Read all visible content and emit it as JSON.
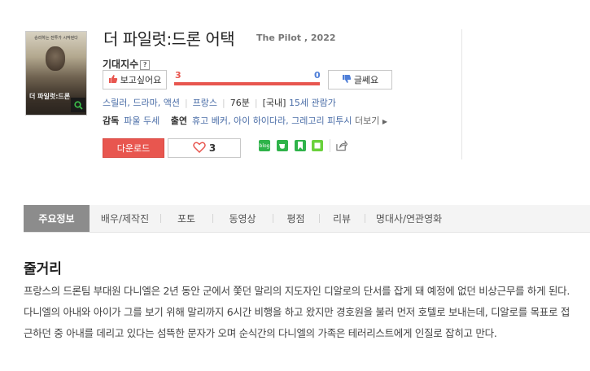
{
  "movie": {
    "title": "더 파일럿:드론 어택",
    "subtitle": "The Pilot , 2022",
    "poster": {
      "top_text": "승리하는 전투가 시작된다",
      "title_text": "더 파일럿:드론"
    }
  },
  "expectation": {
    "label": "기대지수",
    "help_icon": "?",
    "want_label": "보고싶어요",
    "want_count": "3",
    "nah_label": "글쎄요",
    "nah_count": "0",
    "want_ratio": 1.0
  },
  "meta": {
    "genres": "스릴러, 드라마, 액션",
    "country": "프랑스",
    "runtime": "76분",
    "rating_prefix": "[국내]",
    "rating": "15세 관람가"
  },
  "credits": {
    "director_label": "감독",
    "director": "파울 두세",
    "cast_label": "출연",
    "cast": "휴고 베커, 아이 하이다라, 그레고리 피투시",
    "more_label": "더보기"
  },
  "actions": {
    "download_label": "다운로드",
    "like_count": "3",
    "share_icons": [
      {
        "name": "blog-share-icon",
        "color": "#2fb34a",
        "text": "blog"
      },
      {
        "name": "cafe-share-icon",
        "color": "#2fb34a",
        "text": "C"
      },
      {
        "name": "bookmark-share-icon",
        "color": "#2fb34a",
        "text": "B"
      },
      {
        "name": "band-share-icon",
        "color": "#6ad13c",
        "text": "D"
      }
    ]
  },
  "tabs": [
    {
      "label": "주요정보",
      "active": true
    },
    {
      "label": "배우/제작진",
      "active": false
    },
    {
      "label": "포토",
      "active": false
    },
    {
      "label": "동영상",
      "active": false
    },
    {
      "label": "평점",
      "active": false
    },
    {
      "label": "리뷰",
      "active": false
    },
    {
      "label": "명대사/연관영화",
      "active": false
    }
  ],
  "synopsis": {
    "heading": "줄거리",
    "text": "프랑스의 드론팀 부대원 다니엘은 2년 동안 군에서 쫓던 말리의 지도자인 디알로의 단서를 잡게 돼 예정에 없던 비상근무를 하게 된다. 다니엘의 아내와 아이가 그를 보기 위해 말리까지 6시간 비행을 하고 왔지만 경호원을 불러 먼저 호텔로 보내는데, 디알로를 목표로 접근하던 중 아내를 데리고 있다는 섬뜩한 문자가 오며 순식간의 다니엘의 가족은 테러리스트에게 인질로 잡히고 만다."
  },
  "colors": {
    "accent": "#e8564f",
    "blue": "#4f7fd8",
    "link": "#4a6da7",
    "tab_active": "#8c8c8c"
  }
}
